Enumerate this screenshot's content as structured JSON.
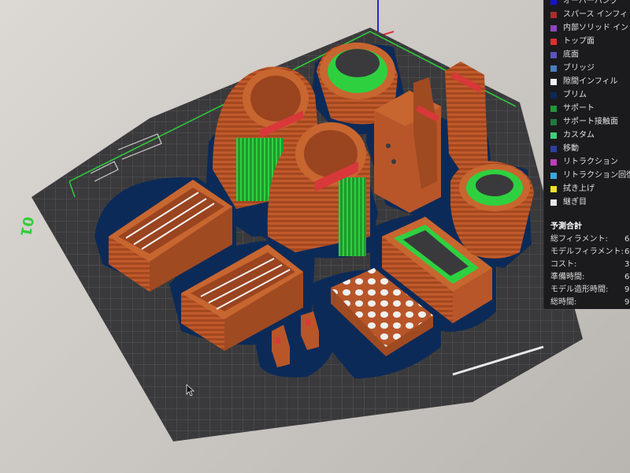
{
  "legend": {
    "items": [
      {
        "label": "オーバーハング",
        "color": "#1414d2"
      },
      {
        "label": "スパース インフィ",
        "color": "#b02a2a"
      },
      {
        "label": "内部ソリッド イン",
        "color": "#8e44c8"
      },
      {
        "label": "トップ面",
        "color": "#e03030"
      },
      {
        "label": "底面",
        "color": "#5a54c4"
      },
      {
        "label": "ブリッジ",
        "color": "#4a7cc4"
      },
      {
        "label": "隙間インフィル",
        "color": "#f2f2f2"
      },
      {
        "label": "ブリム",
        "color": "#0a2a5a"
      },
      {
        "label": "サポート",
        "color": "#1e9a3a"
      },
      {
        "label": "サポート接触面",
        "color": "#1e7a3a"
      },
      {
        "label": "カスタム",
        "color": "#3ad47a"
      },
      {
        "label": "移動",
        "color": "#2b3fa8"
      },
      {
        "label": "リトラクション",
        "color": "#c43ac4"
      },
      {
        "label": "リトラクション回復",
        "color": "#3aa8e0"
      },
      {
        "label": "拭き上げ",
        "color": "#f0e02a"
      },
      {
        "label": "継ぎ目",
        "color": "#e8e8e8"
      }
    ]
  },
  "stats": {
    "title": "予測合計",
    "rows": [
      {
        "label": "総フィラメント:",
        "value": "6"
      },
      {
        "label": "モデルフィラメント:",
        "value": "6"
      },
      {
        "label": "コスト:",
        "value": "3"
      },
      {
        "label": "準備時間:",
        "value": "6"
      },
      {
        "label": "モデル造形時間:",
        "value": "9"
      },
      {
        "label": "総時間:",
        "value": "9"
      }
    ]
  },
  "bed": {
    "plate_number": "01"
  },
  "colors": {
    "bed": "#3b3b3d",
    "grid": "#56565a",
    "model": "#b8562a",
    "model_dark": "#7a3216",
    "brim": "#0c2a58",
    "support": "#2fcf3a",
    "top_surface": "#d8383a"
  }
}
